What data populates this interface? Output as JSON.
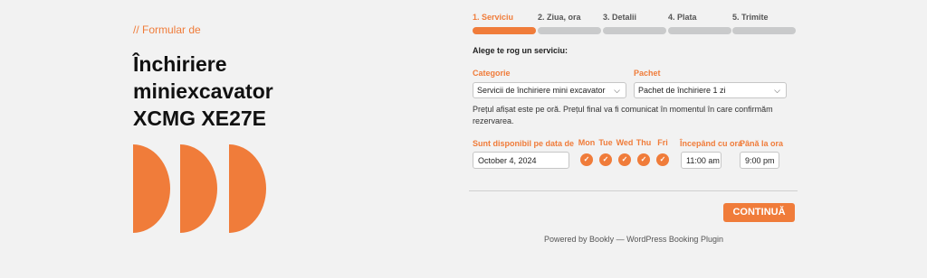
{
  "hero": {
    "eyebrow": "// Formular de",
    "title_lines": [
      "Închiriere",
      "miniexcavator",
      "XCMG XE27E"
    ]
  },
  "steps": [
    {
      "label": "1. Serviciu",
      "active": true
    },
    {
      "label": "2. Ziua, ora",
      "active": false
    },
    {
      "label": "3. Detalii",
      "active": false
    },
    {
      "label": "4. Plata",
      "active": false
    },
    {
      "label": "5. Trimite",
      "active": false
    }
  ],
  "service": {
    "prompt": "Alege te rog un serviciu:",
    "category_label": "Categorie",
    "category_value": "Servicii de închiriere mini excavator",
    "package_label": "Pachet",
    "package_value": "Pachet de închiriere 1 zi",
    "info": "Prețul afișat este pe oră. Prețul final va fi comunicat în momentul în care confirmăm rezervarea."
  },
  "availability": {
    "date_label": "Sunt disponibil pe data de",
    "date_value": "October 4, 2024",
    "days": [
      "Mon",
      "Tue",
      "Wed",
      "Thu",
      "Fri"
    ],
    "from_label": "Începând cu ora",
    "from_value": "11:00 am",
    "to_label": "Până la ora",
    "to_value": "9:00 pm"
  },
  "actions": {
    "continue_label": "CONTINUĂ"
  },
  "footer": {
    "powered": "Powered by Bookly — WordPress Booking Plugin"
  },
  "colors": {
    "accent": "#f07c3a",
    "inactive_step": "#c9cacb",
    "background": "#f2f2f2"
  }
}
